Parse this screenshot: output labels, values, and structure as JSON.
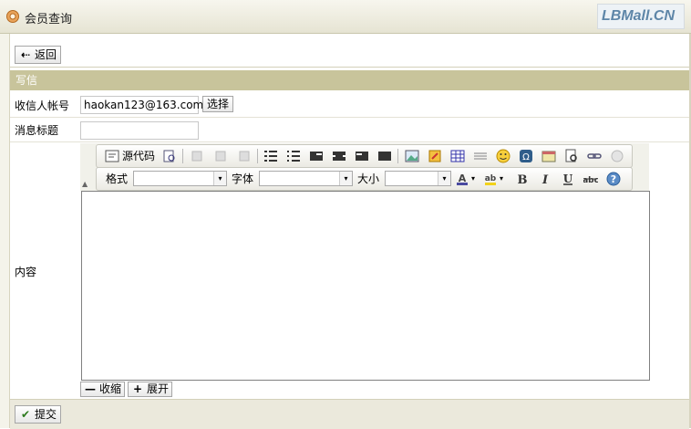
{
  "window": {
    "title": "会员查询",
    "logo_text": "LBMall.CN"
  },
  "actions": {
    "back_label": "返回",
    "submit_label": "提交"
  },
  "section": {
    "title": "写信"
  },
  "form": {
    "recipient_label": "收信人帐号",
    "recipient_value": "haokan123@163.com",
    "choose_label": "选择",
    "subject_label": "消息标题",
    "subject_value": "",
    "content_label": "内容"
  },
  "editor": {
    "source_label": "源代码",
    "format_label": "格式",
    "font_label": "字体",
    "size_label": "大小",
    "format_value": "",
    "font_value": "",
    "size_value": "",
    "shrink_label": "收缩",
    "expand_label": "展开"
  }
}
